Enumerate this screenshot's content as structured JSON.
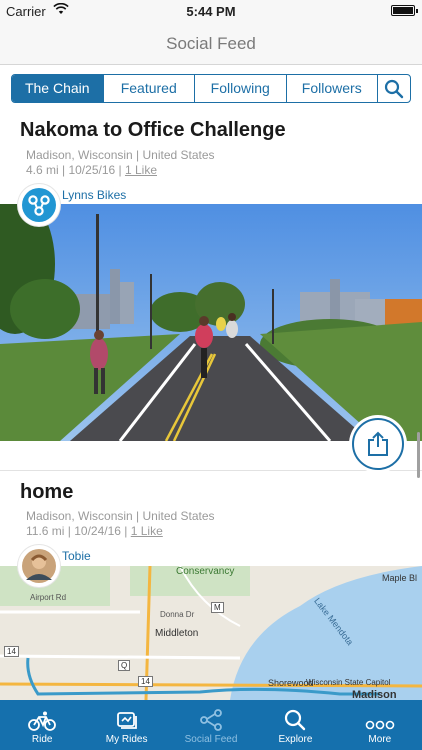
{
  "status_bar": {
    "carrier": "Carrier",
    "time": "5:44 PM"
  },
  "nav": {
    "title": "Social Feed"
  },
  "segments": [
    {
      "label": "The Chain",
      "active": true
    },
    {
      "label": "Featured",
      "active": false
    },
    {
      "label": "Following",
      "active": false
    },
    {
      "label": "Followers",
      "active": false
    }
  ],
  "posts": [
    {
      "title": "Nakoma to Office Challenge",
      "location": "Madison, Wisconsin | United States",
      "stats": "4.6 mi | 10/25/16 | ",
      "likes": "1 Like",
      "author": "Lynns Bikes"
    },
    {
      "title": "home",
      "location": "Madison, Wisconsin | United States",
      "stats": "11.6 mi | 10/24/16 | ",
      "likes": "1 Like",
      "author": "Tobie"
    }
  ],
  "map_labels": {
    "conservancy": "Conservancy",
    "airport_rd": "Airport Rd",
    "donna_dr": "Donna Dr",
    "middleton": "Middleton",
    "lake": "Lake Mendota",
    "maple_bluff": "Maple Bl",
    "shorewood": "Shorewood",
    "capitol": "Wisconsin State Capitol",
    "madison": "Madison",
    "hwy_m": "M",
    "hwy_14a": "14",
    "hwy_14b": "14",
    "hwy_q": "Q"
  },
  "tabs": [
    {
      "label": "Ride",
      "icon": "bike-icon",
      "active": false
    },
    {
      "label": "My Rides",
      "icon": "my-rides-icon",
      "active": false
    },
    {
      "label": "Social Feed",
      "icon": "share-network-icon",
      "active": true
    },
    {
      "label": "Explore",
      "icon": "search-icon",
      "active": false
    },
    {
      "label": "More",
      "icon": "more-icon",
      "active": false
    }
  ],
  "colors": {
    "accent": "#1d6fa6",
    "tab_bar": "#1570ad",
    "route": "#3a9ac9"
  }
}
